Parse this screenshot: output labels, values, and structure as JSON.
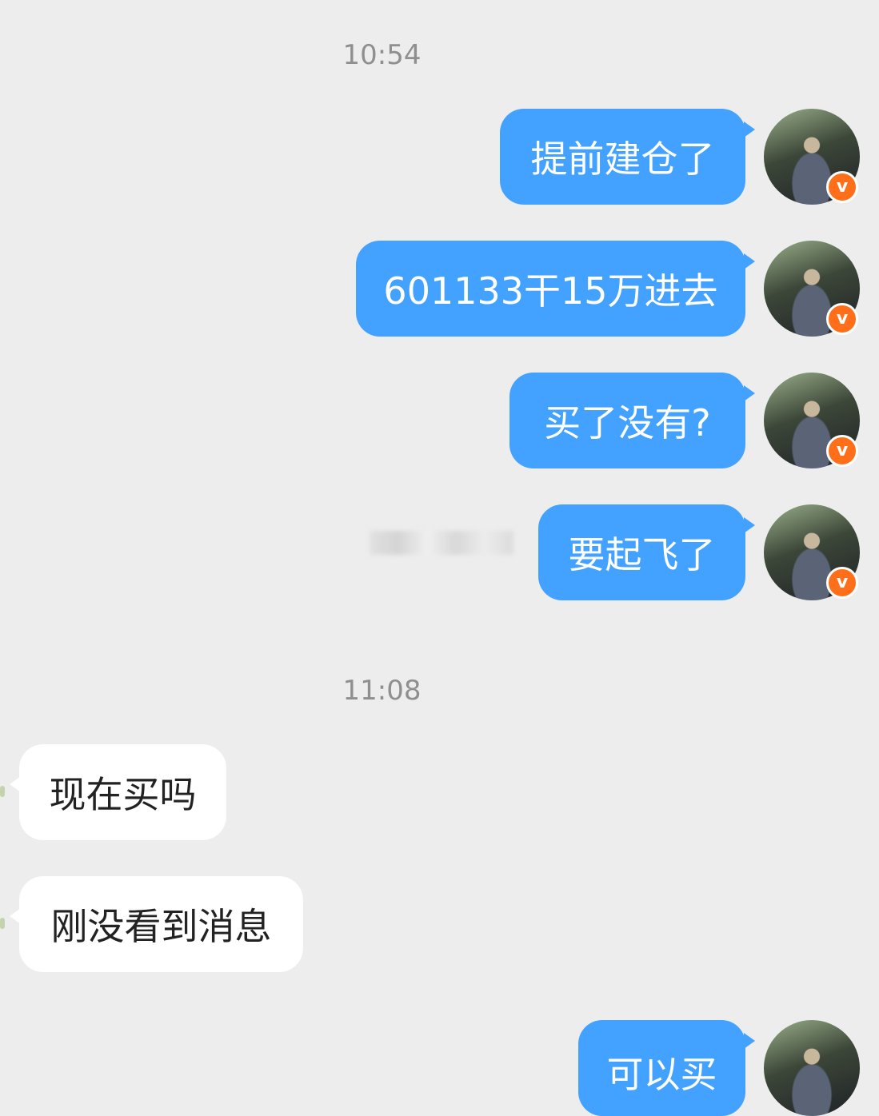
{
  "timestamps": [
    "10:54",
    "11:08"
  ],
  "messages": [
    {
      "side": "outgoing",
      "text": "提前建仓了"
    },
    {
      "side": "outgoing",
      "text": "601133干15万进去"
    },
    {
      "side": "outgoing",
      "text": "买了没有?"
    },
    {
      "side": "outgoing",
      "text": "要起飞了"
    },
    {
      "side": "incoming",
      "text": "现在买吗"
    },
    {
      "side": "incoming",
      "text": "刚没看到消息"
    },
    {
      "side": "outgoing",
      "text": "可以买"
    }
  ],
  "avatar": {
    "badge": "v",
    "badge_color": "#ff6f1a"
  },
  "colors": {
    "outgoing_bubble": "#43a1ff",
    "incoming_bubble": "#ffffff",
    "background": "#ededed"
  }
}
